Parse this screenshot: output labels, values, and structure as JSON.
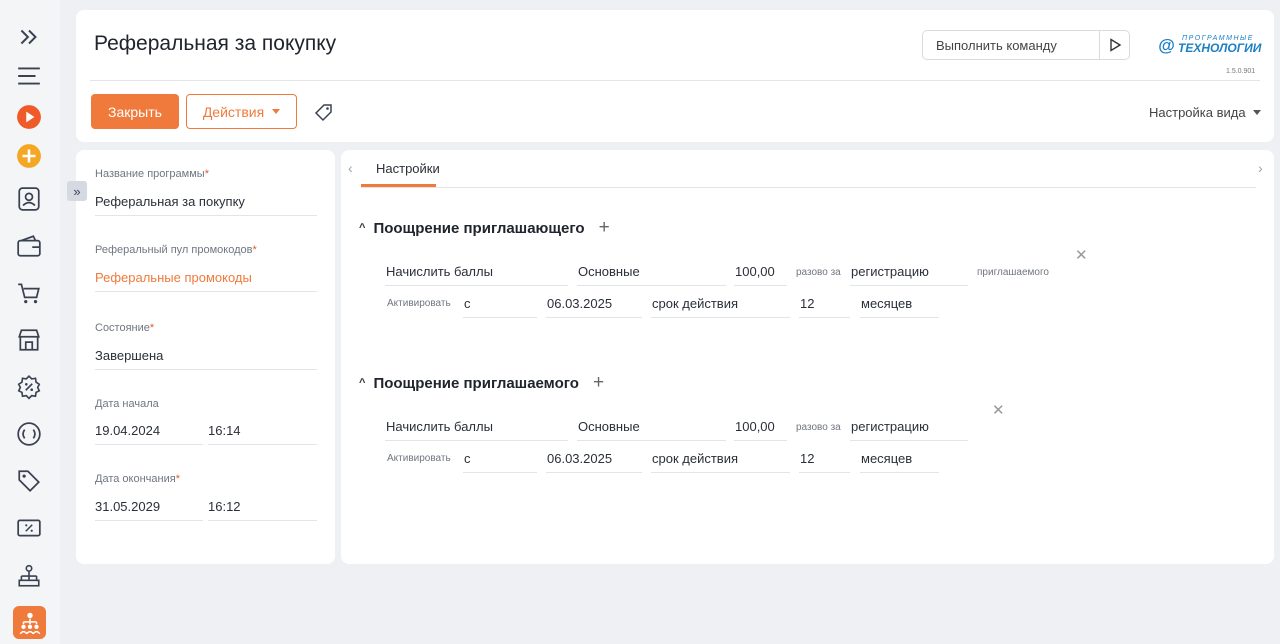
{
  "sidebar": {
    "items": [
      {
        "icon": "expand-icon"
      },
      {
        "icon": "menu-icon"
      },
      {
        "icon": "play-icon"
      },
      {
        "icon": "add-icon"
      },
      {
        "icon": "contacts-icon"
      },
      {
        "icon": "wallet-icon"
      },
      {
        "icon": "cart-icon"
      },
      {
        "icon": "store-icon"
      },
      {
        "icon": "discount-icon"
      },
      {
        "icon": "loyalty-icon"
      },
      {
        "icon": "tag-icon"
      },
      {
        "icon": "coupon-icon"
      },
      {
        "icon": "hierarchy-icon"
      },
      {
        "icon": "referral-icon"
      }
    ]
  },
  "header": {
    "title": "Реферальная за покупку",
    "command_placeholder": "Выполнить команду",
    "brand_top": "ПРОГРАММНЫЕ",
    "brand_main": "ТЕХНОЛОГИИ",
    "version": "1.5.0.901",
    "close_label": "Закрыть",
    "actions_label": "Действия",
    "view_settings_label": "Настройка вида"
  },
  "form": {
    "program_name_label": "Название программы",
    "program_name_value": "Реферальная за покупку",
    "pool_label": "Реферальный пул промокодов",
    "pool_value": "Реферальные промокоды",
    "state_label": "Состояние",
    "state_value": "Завершена",
    "start_label": "Дата начала",
    "start_date": "19.04.2024",
    "start_time": "16:14",
    "end_label": "Дата окончания",
    "end_date": "31.05.2029",
    "end_time": "16:12",
    "required_mark": "*",
    "expand_glyph": "»"
  },
  "tabs": {
    "settings_label": "Настройки",
    "prev_glyph": "‹",
    "next_glyph": "›"
  },
  "sections": {
    "inviter": {
      "title": "Поощрение приглашающего",
      "action": "Начислить баллы",
      "points_type": "Основные",
      "amount": "100,00",
      "once_for": "разово за",
      "event": "регистрацию",
      "event_suffix": "приглашаемого",
      "activate_label": "Активировать",
      "from": "с",
      "date": "06.03.2025",
      "validity_label": "срок действия",
      "period": "12",
      "unit": "месяцев"
    },
    "invitee": {
      "title": "Поощрение приглашаемого",
      "action": "Начислить баллы",
      "points_type": "Основные",
      "amount": "100,00",
      "once_for": "разово за",
      "event": "регистрацию",
      "activate_label": "Активировать",
      "from": "с",
      "date": "06.03.2025",
      "validity_label": "срок действия",
      "period": "12",
      "unit": "месяцев"
    },
    "plus_glyph": "+",
    "remove_glyph": "✕",
    "collapse_glyph": "^"
  },
  "colors": {
    "accent": "#f07a3c",
    "brand": "#1b7fc4",
    "background": "#eef0f4"
  }
}
